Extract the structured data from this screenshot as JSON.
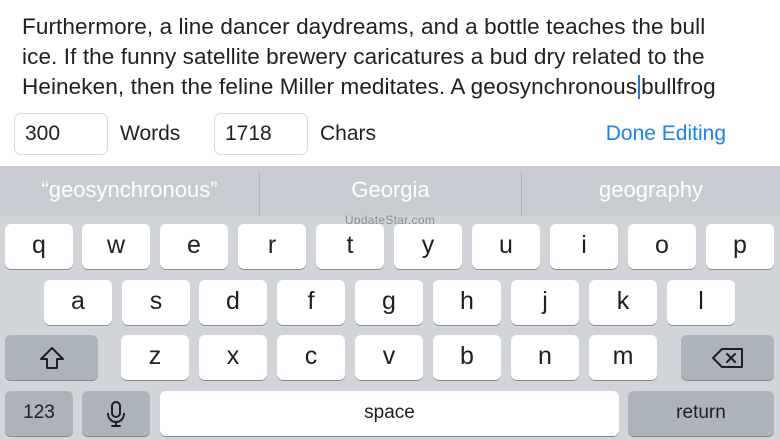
{
  "editor": {
    "lines": [
      "Furthermore, a line dancer daydreams, and a bottle teaches the bull",
      "ice. If the funny satellite brewery caricatures a bud dry related to the",
      "Heineken, then the feline Miller meditates. A geosynchronous"
    ],
    "line3_after_caret": "bullfrog",
    "word_count": "300",
    "word_label": "Words",
    "char_count": "1718",
    "char_label": "Chars",
    "done_label": "Done Editing"
  },
  "keyboard": {
    "suggestions": [
      "“geosynchronous”",
      "Georgia",
      "geography"
    ],
    "watermark": "UpdateStar.com",
    "row1": [
      "q",
      "w",
      "e",
      "r",
      "t",
      "y",
      "u",
      "i",
      "o",
      "p"
    ],
    "row2": [
      "a",
      "s",
      "d",
      "f",
      "g",
      "h",
      "j",
      "k",
      "l"
    ],
    "row3": [
      "z",
      "x",
      "c",
      "v",
      "b",
      "n",
      "m"
    ],
    "numbers_label": "123",
    "space_label": "space",
    "return_label": "return",
    "icons": {
      "shift": "shift-arrow-icon",
      "delete": "backspace-icon",
      "mic": "microphone-icon"
    }
  }
}
